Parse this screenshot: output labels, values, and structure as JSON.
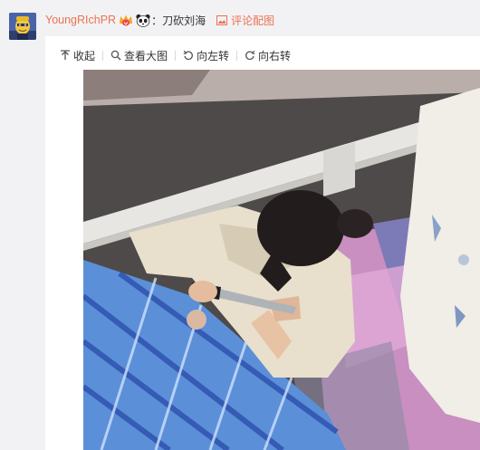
{
  "comment": {
    "username": "YoungRIchPR",
    "colon": "：",
    "text": "刀砍刘海",
    "pic_link_label": "评论配图"
  },
  "toolbar": {
    "collapse": "收起",
    "view_large": "查看大图",
    "rotate_left": "向左转",
    "rotate_right": "向右转"
  },
  "icons": {
    "avatar": "avatar-image",
    "vip": "vip-crown-icon",
    "panda": "panda-emoji-icon",
    "pic": "picture-icon",
    "collapse": "collapse-arrow-icon",
    "view_large": "magnifier-icon",
    "rotate_left": "rotate-left-icon",
    "rotate_right": "rotate-right-icon"
  },
  "colors": {
    "link": "#eb7350",
    "row_background": "#f2f2f5",
    "panel_background": "#ffffff"
  }
}
